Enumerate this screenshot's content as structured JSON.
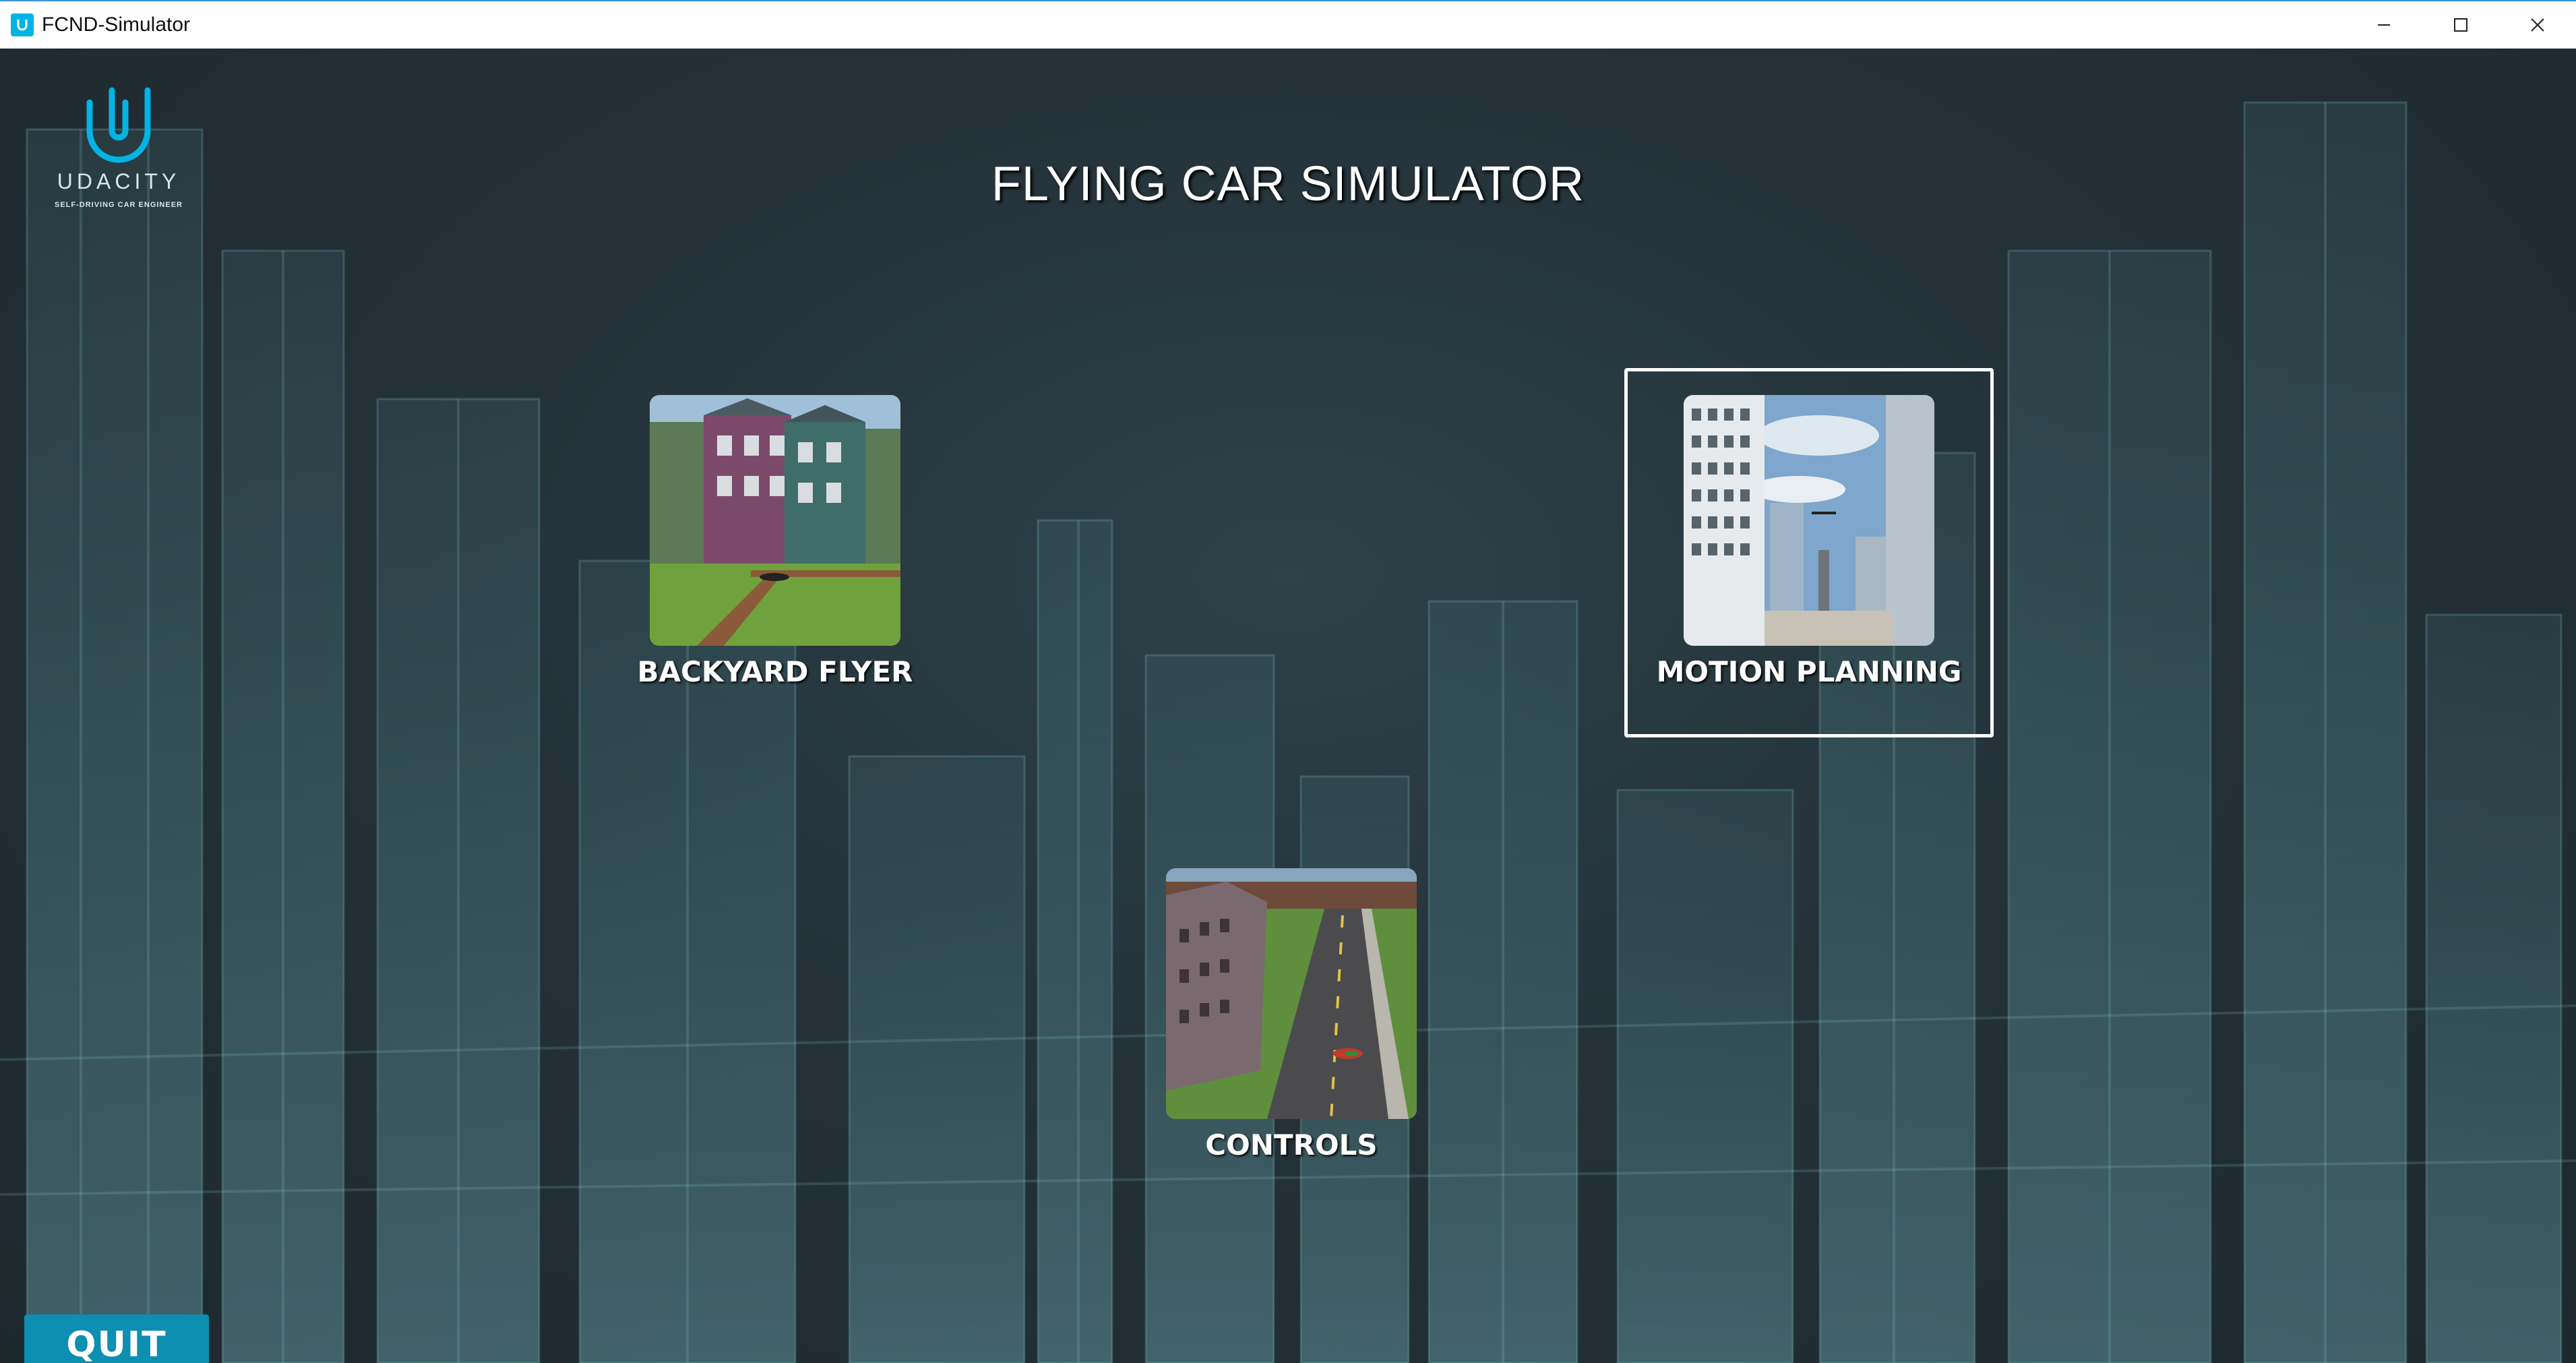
{
  "window": {
    "title": "FCND-Simulator",
    "controls": [
      "minimize",
      "maximize",
      "close"
    ]
  },
  "logo": {
    "word": "UDACITY",
    "subtitle": "SELF-DRIVING CAR ENGINEER"
  },
  "main": {
    "title": "FLYING CAR SIMULATOR",
    "scenes": [
      {
        "label": "BACKYARD FLYER",
        "selected": false
      },
      {
        "label": "MOTION PLANNING",
        "selected": true
      },
      {
        "label": "CONTROLS",
        "selected": false
      }
    ]
  },
  "quit_label": "QUIT",
  "colors": {
    "accent": "#02b3e4",
    "quit_button": "#0c8fb0",
    "background": "#243238",
    "selection_border": "#ffffff"
  }
}
